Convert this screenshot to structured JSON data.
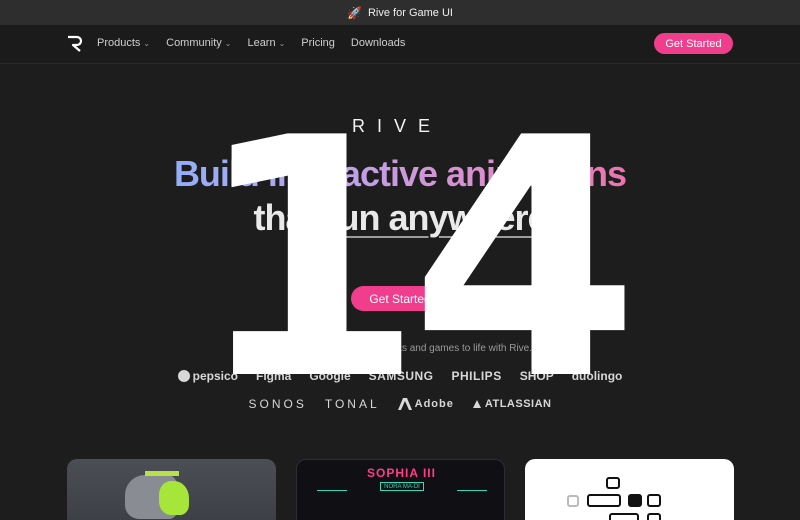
{
  "promo": {
    "icon": "rocket-icon",
    "text": "Rive for Game UI"
  },
  "nav": {
    "items": [
      {
        "label": "Products",
        "has_dropdown": true
      },
      {
        "label": "Community",
        "has_dropdown": true
      },
      {
        "label": "Learn",
        "has_dropdown": true
      },
      {
        "label": "Pricing",
        "has_dropdown": false
      },
      {
        "label": "Downloads",
        "has_dropdown": false
      }
    ],
    "cta": "Get Started"
  },
  "hero": {
    "wordmark": "RIVE",
    "headline_line1": "Build interactive animations",
    "headline_line2_prefix": "that ",
    "headline_line2_underlined": "run anywhere",
    "cta": "Get Started",
    "trust_text": "Companies bring their products and games to life with Rive."
  },
  "logos": {
    "row1": [
      "pepsico",
      "Figma",
      "Google",
      "SAMSUNG",
      "PHILIPS",
      "SHOP",
      "duolingo"
    ],
    "row2": [
      "SONOS",
      "TONAL",
      "Adobe",
      "ATLASSIAN"
    ]
  },
  "overlay_number": "14",
  "cards": {
    "card2_title": "SOPHIA III",
    "card2_sub": "NORA MA-DI"
  },
  "colors": {
    "accent": "#f13e8c",
    "background": "#1d1d1d"
  }
}
